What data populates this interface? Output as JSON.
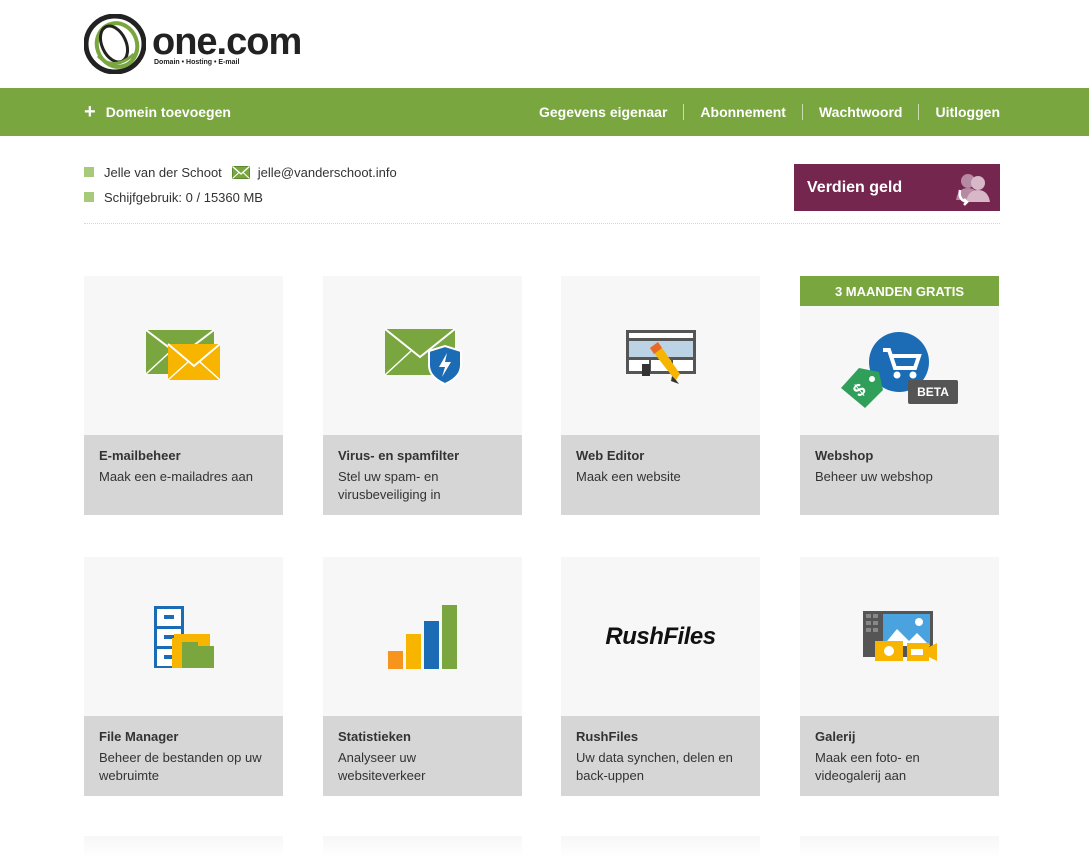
{
  "logo": {
    "name": "one.com",
    "tagline": "Domain • Hosting • E-mail"
  },
  "nav": {
    "add_domain": "Domein toevoegen",
    "links": [
      "Gegevens eigenaar",
      "Abonnement",
      "Wachtwoord",
      "Uitloggen"
    ]
  },
  "account": {
    "name": "Jelle van der Schoot",
    "email": "jelle@vanderschoot.info",
    "disk_usage": "Schijfgebruik: 0 / 15360 MB"
  },
  "earn_button": "Verdien geld",
  "tiles": [
    {
      "title": "E-mailbeheer",
      "desc": "Maak een e-mailadres aan",
      "icon": "envelopes-icon"
    },
    {
      "title": "Virus- en spamfilter",
      "desc": "Stel uw spam- en virusbeveiliging in",
      "icon": "envelope-shield-icon"
    },
    {
      "title": "Web Editor",
      "desc": "Maak een website",
      "icon": "web-editor-icon"
    },
    {
      "title": "Webshop",
      "desc": "Beheer uw webshop",
      "icon": "shopping-cart-icon",
      "promo": "3 MAANDEN GRATIS",
      "badge": "BETA"
    },
    {
      "title": "File Manager",
      "desc": "Beheer de bestanden op uw webruimte",
      "icon": "file-cabinet-icon"
    },
    {
      "title": "Statistieken",
      "desc": "Analyseer uw websiteverkeer",
      "icon": "bar-chart-icon"
    },
    {
      "title": "RushFiles",
      "desc": "Uw data synchen, delen en back-uppen",
      "icon": "rushfiles-logo",
      "logo_text": "RushFiles"
    },
    {
      "title": "Galerij",
      "desc": "Maak een foto- en videogalerij aan",
      "icon": "gallery-icon"
    }
  ],
  "colors": {
    "green": "#7aa640",
    "purple": "#74264f",
    "tile_bg": "#f7f7f7",
    "tile_footer": "#d6d6d6"
  }
}
